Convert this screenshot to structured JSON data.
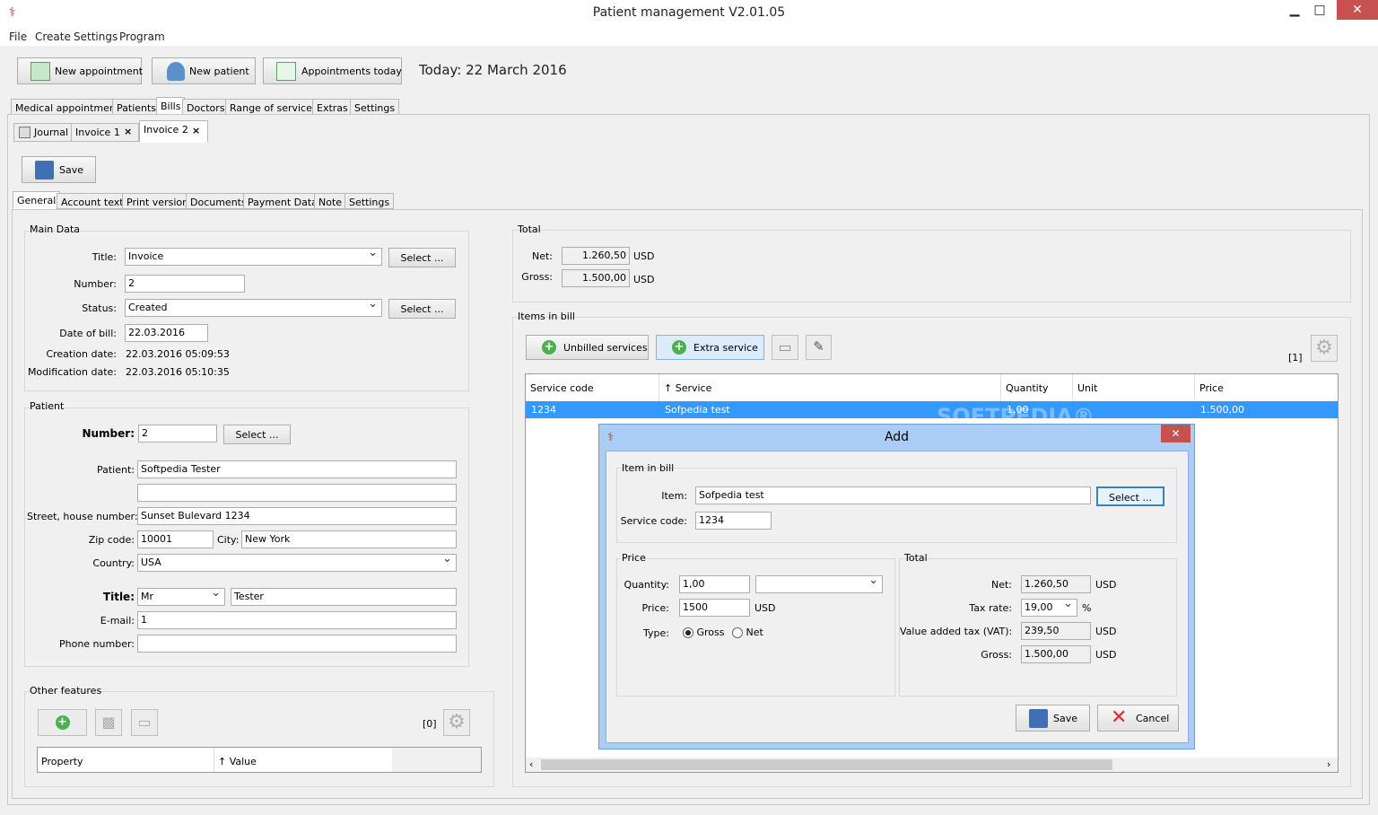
{
  "window": {
    "title": "Patient management V2.01.05",
    "minimize": "▁",
    "maximize": "□",
    "close": "✕"
  },
  "menu": [
    "File",
    "Create",
    "Settings",
    "Program"
  ],
  "toolbar": {
    "new_appointment": "New appointment",
    "new_patient": "New patient",
    "appointments_today": "Appointments today",
    "today": "Today: 22 March 2016"
  },
  "main_tabs": [
    "Medical appointments",
    "Patients",
    "Bills",
    "Doctors",
    "Range of services",
    "Extras",
    "Settings"
  ],
  "doc_tabs": {
    "journal": "Journal",
    "invoice1": "Invoice 1",
    "invoice2": "Invoice 2",
    "close": "×"
  },
  "save_label": "Save",
  "sub_tabs": [
    "General",
    "Account text",
    "Print version",
    "Documents",
    "Payment Data",
    "Note",
    "Settings"
  ],
  "main_data": {
    "legend": "Main Data",
    "title_label": "Title:",
    "title_value": "Invoice",
    "number_label": "Number:",
    "number_value": "2",
    "status_label": "Status:",
    "status_value": "Created",
    "date_label": "Date of bill:",
    "date_value": "22.03.2016",
    "creation_label": "Creation date:",
    "creation_value": "22.03.2016  05:09:53",
    "mod_label": "Modification date:",
    "mod_value": "22.03.2016  05:10:35",
    "select": "Select ..."
  },
  "patient": {
    "legend": "Patient",
    "number_label": "Number:",
    "number_value": "2",
    "patient_label": "Patient:",
    "patient_value": "Softpedia Tester",
    "patient_line2": "",
    "street_label": "Street, house number:",
    "street_value": "Sunset Bulevard 1234",
    "zip_label": "Zip code:",
    "zip_value": "10001",
    "city_label": "City:",
    "city_value": "New York",
    "country_label": "Country:",
    "country_value": "USA",
    "title_label": "Title:",
    "title_value": "Mr",
    "name_value": "Tester",
    "email_label": "E-mail:",
    "email_value": "1",
    "phone_label": "Phone number:",
    "phone_value": "",
    "select": "Select ..."
  },
  "other": {
    "legend": "Other features",
    "count": "[0]",
    "col_property": "Property",
    "col_value": "↑ Value"
  },
  "total": {
    "legend": "Total",
    "net_label": "Net:",
    "net_value": "1.260,50",
    "gross_label": "Gross:",
    "gross_value": "1.500,00",
    "currency": "USD"
  },
  "items": {
    "legend": "Items in bill",
    "unbilled": "Unbilled services",
    "extra": "Extra service",
    "count": "[1]",
    "columns": [
      "Service code",
      "↑ Service",
      "Quantity",
      "Unit",
      "Price"
    ],
    "row": {
      "code": "1234",
      "service": "Sofpedia test",
      "quantity": "1,00",
      "unit": "",
      "price": "1.500,00"
    },
    "watermark": "SOFTPEDIA®"
  },
  "dialog": {
    "title": "Add",
    "close": "✕",
    "item_legend": "Item in bill",
    "item_label": "Item:",
    "item_value": "Sofpedia test",
    "select": "Select ...",
    "code_label": "Service code:",
    "code_value": "1234",
    "price_legend": "Price",
    "qty_label": "Quantity:",
    "qty_value": "1,00",
    "unit_value": "",
    "price_label": "Price:",
    "price_value": "1500",
    "currency": "USD",
    "type_label": "Type:",
    "gross": "Gross",
    "net": "Net",
    "total_legend": "Total",
    "net_label": "Net:",
    "net_value": "1.260,50",
    "tax_label": "Tax rate:",
    "tax_value": "19,00",
    "percent": "%",
    "vat_label": "Value added tax (VAT):",
    "vat_value": "239,50",
    "gross_label": "Gross:",
    "gross_value": "1.500,00",
    "save": "Save",
    "cancel": "Cancel"
  }
}
